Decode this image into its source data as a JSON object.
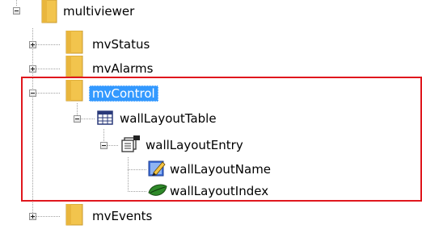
{
  "tree": {
    "root": {
      "label": "multiviewer",
      "icon": "folder-icon",
      "expanded": true
    },
    "nodes": [
      {
        "label": "mvStatus",
        "icon": "folder-icon",
        "expanded": false
      },
      {
        "label": "mvAlarms",
        "icon": "folder-icon",
        "expanded": false
      },
      {
        "label": "mvControl",
        "icon": "folder-icon",
        "expanded": true,
        "selected": true,
        "children": [
          {
            "label": "wallLayoutTable",
            "icon": "table-icon",
            "expanded": true,
            "children": [
              {
                "label": "wallLayoutEntry",
                "icon": "entry-icon",
                "expanded": true,
                "children": [
                  {
                    "label": "wallLayoutName",
                    "icon": "pencil-leaf-icon"
                  },
                  {
                    "label": "wallLayoutIndex",
                    "icon": "leaf-icon"
                  }
                ]
              }
            ]
          }
        ]
      },
      {
        "label": "mvEvents",
        "icon": "folder-icon",
        "expanded": false
      }
    ]
  },
  "colors": {
    "selection": "#3399ff",
    "highlight_border": "#e0171d",
    "folder": "#f2c44d"
  }
}
